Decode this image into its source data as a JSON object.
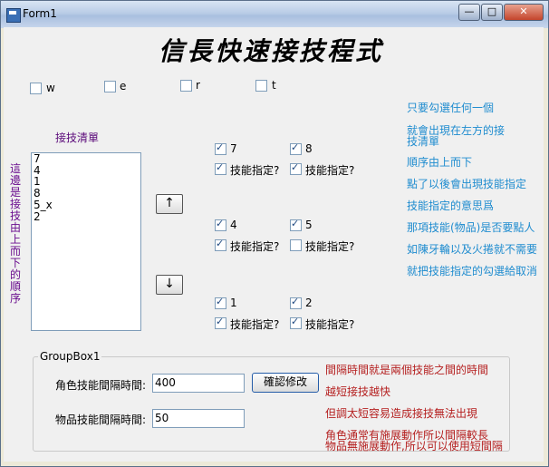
{
  "window": {
    "title": "Form1",
    "minimize": "—",
    "maximize": "□",
    "close": "✕"
  },
  "heading": "信長快速接技程式",
  "top_checkboxes": [
    {
      "label": "w",
      "checked": false
    },
    {
      "label": "e",
      "checked": false
    },
    {
      "label": "r",
      "checked": false
    },
    {
      "label": "t",
      "checked": false
    }
  ],
  "list": {
    "title": "接技清單",
    "items": [
      "7",
      "4",
      "1",
      "8",
      "5_x",
      "2"
    ]
  },
  "vertical_note": "這邊是接技由上而下的順序",
  "buttons": {
    "up": "↑",
    "down": "↓",
    "confirm": "確認修改"
  },
  "skills": [
    {
      "key": "7",
      "key_checked": true,
      "assign": "技能指定?",
      "assign_checked": true
    },
    {
      "key": "8",
      "key_checked": true,
      "assign": "技能指定?",
      "assign_checked": true
    },
    {
      "key": "4",
      "key_checked": true,
      "assign": "技能指定?",
      "assign_checked": true
    },
    {
      "key": "5",
      "key_checked": true,
      "assign": "技能指定?",
      "assign_checked": false
    },
    {
      "key": "1",
      "key_checked": true,
      "assign": "技能指定?",
      "assign_checked": true
    },
    {
      "key": "2",
      "key_checked": true,
      "assign": "技能指定?",
      "assign_checked": true
    }
  ],
  "instructions": [
    "只要勾選任何一個",
    "就會出現在左方的接",
    "技清單",
    "順序由上而下",
    "點了以後會出現技能指定",
    "技能指定的意思爲",
    "那項技能(物品)是否要點人",
    "如陳牙輪以及火捲就不需要",
    "就把技能指定的勾選給取消"
  ],
  "groupbox": {
    "label": "GroupBox1",
    "role_label": "角色技能間隔時間:",
    "role_value": "400",
    "item_label": "物品技能間隔時間:",
    "item_value": "50",
    "notes": [
      "間隔時間就是兩個技能之間的時間",
      "越短接技越快",
      "但調太短容易造成接技無法出現",
      "角色通常有施展動作所以間隔較長",
      "物品無施展動作,所以可以使用短間隔"
    ]
  }
}
